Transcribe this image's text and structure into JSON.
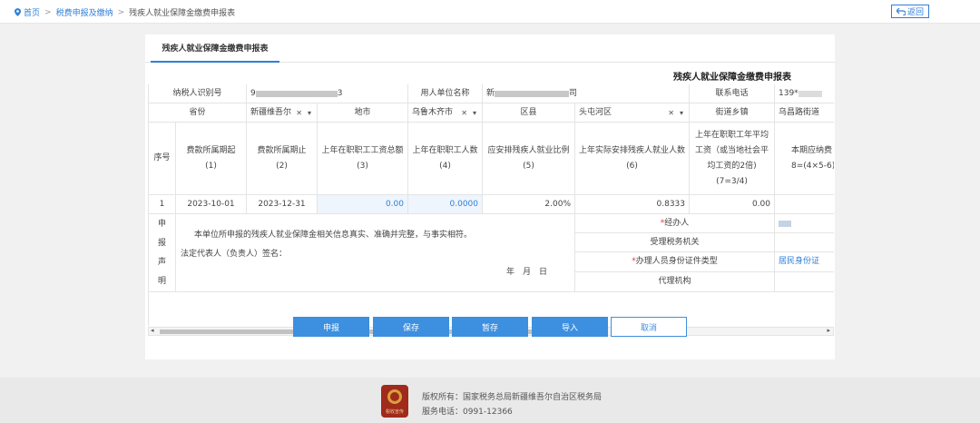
{
  "breadcrumb": {
    "home": "首页",
    "level1": "税费申报及缴纳",
    "current": "残疾人就业保障金缴费申报表"
  },
  "back_label": "返回",
  "tab_label": "残疾人就业保障金缴费申报表",
  "form_title": "残疾人就业保障金缴费申报表",
  "info": {
    "taxpayer_id_label": "纳税人识别号",
    "taxpayer_id_prefix": "9",
    "taxpayer_id_suffix": "3",
    "employer_name_label": "用人单位名称",
    "employer_name_prefix": "新",
    "employer_name_suffix": "司",
    "phone_label": "联系电话",
    "phone_prefix": "139*",
    "province_label": "省份",
    "province_value": "新疆维吾尔",
    "city_label": "地市",
    "city_value": "乌鲁木齐市",
    "county_label": "区县",
    "county_value": "头屯河区",
    "street_label": "街道乡镇",
    "street_value": "乌昌路街道"
  },
  "columns": [
    {
      "label": "序号",
      "num": ""
    },
    {
      "label": "费款所属期起",
      "num": "(1)"
    },
    {
      "label": "费款所属期止",
      "num": "(2)"
    },
    {
      "label": "上年在职职工工资总额",
      "num": "(3)"
    },
    {
      "label": "上年在职职工人数",
      "num": "(4)"
    },
    {
      "label": "应安排残疾人就业比例",
      "num": "(5)"
    },
    {
      "label": "上年实际安排残疾人就业人数",
      "num": "(6)"
    },
    {
      "label": "上年在职职工年平均工资（或当地社会平均工资的2倍)",
      "num": "(7=3/4)"
    },
    {
      "label": "本期应纳费",
      "num": "8=(4×5-6)"
    }
  ],
  "row": {
    "seq": "1",
    "start": "2023-10-01",
    "end": "2023-12-31",
    "wage_total": "0.00",
    "staff_count": "0.0000",
    "ratio": "2.00%",
    "disabled_count": "0.8333",
    "avg_wage": "0.00",
    "payable": ""
  },
  "declaration": {
    "side_label": [
      "申",
      "报",
      "声",
      "明"
    ],
    "text": "本单位所申报的残疾人就业保障金相关信息真实、准确并完整，与事实相符。",
    "sign": "法定代表人（负责人）签名：",
    "date": "年　月　日",
    "handler_label": "经办人",
    "tax_office_label": "受理税务机关",
    "id_type_label": "办理人员身份证件类型",
    "id_type_value": "居民身份证",
    "agency_label": "代理机构"
  },
  "buttons": {
    "declare": "申报",
    "save": "保存",
    "stash": "暂存",
    "import": "导入",
    "cancel": "取消"
  },
  "footer": {
    "logo_text": "税收宣传",
    "copyright": "版权所有：国家税务总局新疆维吾尔自治区税务局",
    "service": "服务电话：0991-12366"
  },
  "colors": {
    "accent": "#2f7fd6",
    "button": "#3d8fe0",
    "highlight_cell": "#eef5fd"
  }
}
